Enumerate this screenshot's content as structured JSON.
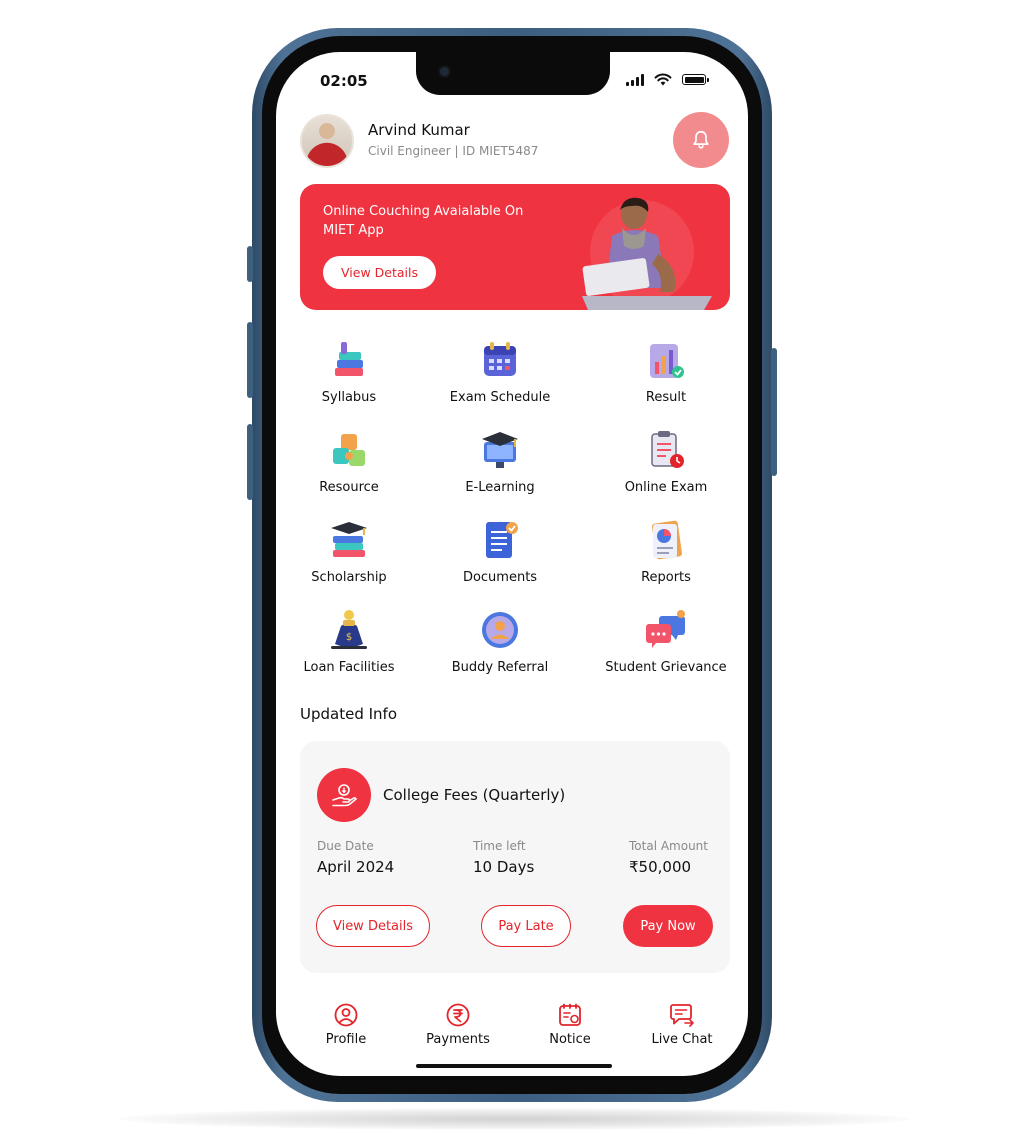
{
  "status_bar": {
    "time": "02:05"
  },
  "profile": {
    "name": "Arvind Kumar",
    "subtitle": "Civil Engineer | ID MIET5487"
  },
  "banner": {
    "text": "Online Couching Avaialable On MIET App",
    "button_label": "View Details"
  },
  "menu": [
    {
      "label": "Syllabus",
      "icon": "syllabus-books-icon"
    },
    {
      "label": "Exam Schedule",
      "icon": "calendar-icon"
    },
    {
      "label": "Result",
      "icon": "result-chart-icon"
    },
    {
      "label": "Resource",
      "icon": "puzzle-icon"
    },
    {
      "label": "E-Learning",
      "icon": "graduation-monitor-icon"
    },
    {
      "label": "Online Exam",
      "icon": "clipboard-clock-icon"
    },
    {
      "label": "Scholarship",
      "icon": "books-cap-icon"
    },
    {
      "label": "Documents",
      "icon": "document-check-icon"
    },
    {
      "label": "Reports",
      "icon": "report-pie-icon"
    },
    {
      "label": "Loan Facilities",
      "icon": "money-bag-icon"
    },
    {
      "label": "Buddy Referral",
      "icon": "user-badge-icon"
    },
    {
      "label": "Student Grievance",
      "icon": "chat-bubbles-icon"
    }
  ],
  "updated_info": {
    "title": "Updated Info",
    "card": {
      "title": "College Fees (Quarterly)",
      "due_date_label": "Due Date",
      "due_date_value": "April 2024",
      "time_left_label": "Time left",
      "time_left_value": "10 Days",
      "total_label": "Total Amount",
      "total_value": "₹50,000",
      "view_details_label": "View Details",
      "pay_late_label": "Pay Late",
      "pay_now_label": "Pay Now"
    }
  },
  "tabs": [
    {
      "label": "Profile",
      "icon": "user-circle-icon"
    },
    {
      "label": "Payments",
      "icon": "rupee-icon"
    },
    {
      "label": "Notice",
      "icon": "notice-icon"
    },
    {
      "label": "Live Chat",
      "icon": "chat-icon"
    }
  ],
  "colors": {
    "accent": "#ef3340",
    "accent_light": "#f28b8e",
    "card_bg": "#f6f6f7",
    "frame": "#3c5e80"
  }
}
